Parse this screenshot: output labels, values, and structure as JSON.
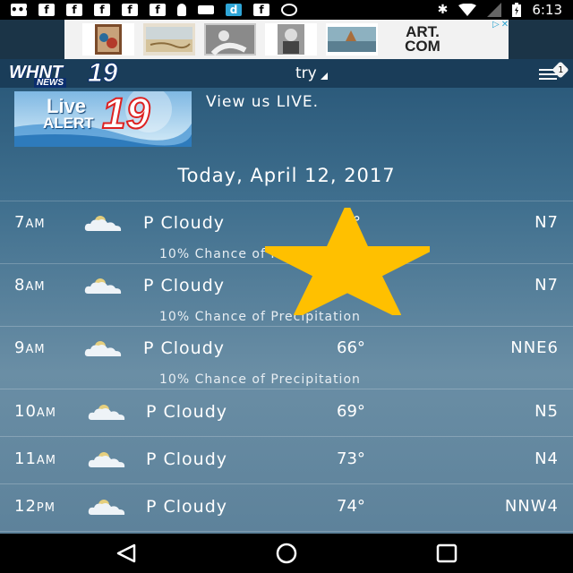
{
  "status_bar": {
    "time": "6:13"
  },
  "ad": {
    "brand": "ART.COM"
  },
  "app": {
    "logo": "WHNT",
    "logo_number": "19",
    "logo_sub": "NEWS",
    "location": "try",
    "notification_count": "1"
  },
  "live": {
    "banner_title": "Live",
    "banner_sub": "ALERT",
    "banner_number": "19",
    "text": "View us LIVE."
  },
  "date_header": "Today, April 12, 2017",
  "forecast": [
    {
      "hour": "7",
      "ampm": "AM",
      "condition": "P Cloudy",
      "temp": "…°",
      "wind": "N7",
      "precip": "10% Chance of Precipitation"
    },
    {
      "hour": "8",
      "ampm": "AM",
      "condition": "P Cloudy",
      "temp": "",
      "wind": "N7",
      "precip": "10% Chance of Precipitation"
    },
    {
      "hour": "9",
      "ampm": "AM",
      "condition": "P Cloudy",
      "temp": "66°",
      "wind": "NNE6",
      "precip": "10% Chance of Precipitation"
    },
    {
      "hour": "10",
      "ampm": "AM",
      "condition": "P Cloudy",
      "temp": "69°",
      "wind": "N5",
      "precip": ""
    },
    {
      "hour": "11",
      "ampm": "AM",
      "condition": "P Cloudy",
      "temp": "73°",
      "wind": "N4",
      "precip": ""
    },
    {
      "hour": "12",
      "ampm": "PM",
      "condition": "P Cloudy",
      "temp": "74°",
      "wind": "NNW4",
      "precip": ""
    }
  ],
  "colors": {
    "star": "#ffc000",
    "app_bar": "#1a3d59",
    "status_bar": "#000000"
  },
  "icons": {
    "condition": "partly-cloudy-icon",
    "favorite": "star-icon",
    "menu": "hamburger-menu-icon",
    "nav": [
      "back-icon",
      "home-icon",
      "recent-apps-icon"
    ]
  }
}
